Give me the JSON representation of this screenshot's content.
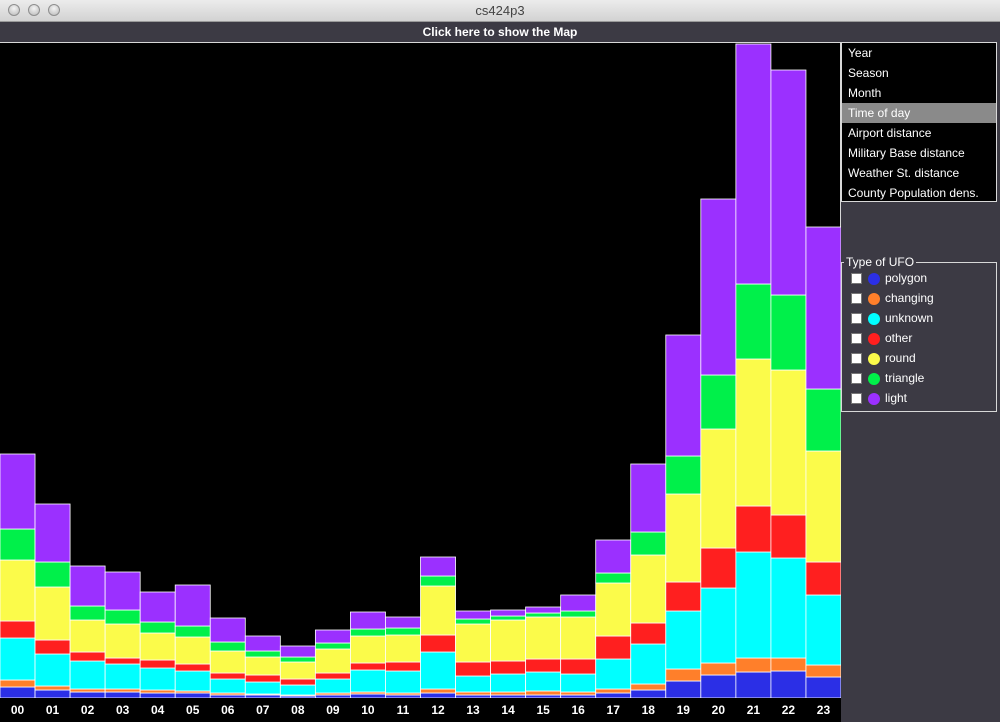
{
  "window": {
    "title": "cs424p3"
  },
  "map_button": "Click here to show the Map",
  "menu": {
    "items": [
      "Year",
      "Season",
      "Month",
      "Time of day",
      "Airport distance",
      "Military Base distance",
      "Weather St. distance",
      "County Population dens."
    ],
    "selected": "Time of day"
  },
  "legend": {
    "title": "Type of UFO",
    "items": [
      {
        "name": "polygon",
        "color": "#2b2fe6"
      },
      {
        "name": "changing",
        "color": "#ff7f2a"
      },
      {
        "name": "unknown",
        "color": "#00ffff"
      },
      {
        "name": "other",
        "color": "#ff1f1f"
      },
      {
        "name": "round",
        "color": "#fbfb4a"
      },
      {
        "name": "triangle",
        "color": "#00f04a"
      },
      {
        "name": "light",
        "color": "#9b30ff"
      }
    ]
  },
  "chart_data": {
    "type": "bar",
    "stacked": true,
    "categories": [
      "00",
      "01",
      "02",
      "03",
      "04",
      "05",
      "06",
      "07",
      "08",
      "09",
      "10",
      "11",
      "12",
      "13",
      "14",
      "15",
      "16",
      "17",
      "18",
      "19",
      "20",
      "21",
      "22",
      "23"
    ],
    "ylim": [
      0,
      655
    ],
    "series": [
      {
        "name": "polygon",
        "color": "#2b2fe6",
        "values": [
          11,
          8,
          6,
          6,
          5,
          5,
          3,
          3,
          2,
          3,
          4,
          3,
          5,
          3,
          3,
          3,
          3,
          5,
          8,
          17,
          23,
          26,
          27,
          21
        ]
      },
      {
        "name": "changing",
        "color": "#ff7f2a",
        "values": [
          7,
          4,
          3,
          3,
          3,
          2,
          2,
          1,
          1,
          2,
          2,
          2,
          4,
          3,
          3,
          4,
          3,
          4,
          6,
          12,
          12,
          14,
          13,
          12
        ]
      },
      {
        "name": "unknown",
        "color": "#00ffff",
        "values": [
          42,
          32,
          28,
          25,
          22,
          20,
          14,
          12,
          10,
          14,
          22,
          22,
          37,
          16,
          18,
          19,
          18,
          30,
          40,
          58,
          75,
          106,
          100,
          70
        ]
      },
      {
        "name": "other",
        "color": "#ff1f1f",
        "values": [
          17,
          14,
          9,
          6,
          8,
          7,
          6,
          7,
          6,
          6,
          7,
          9,
          17,
          14,
          13,
          13,
          15,
          23,
          21,
          29,
          40,
          46,
          43,
          33
        ]
      },
      {
        "name": "round",
        "color": "#fbfb4a",
        "values": [
          61,
          53,
          32,
          34,
          27,
          27,
          22,
          18,
          17,
          24,
          27,
          27,
          49,
          38,
          41,
          42,
          42,
          53,
          68,
          88,
          119,
          147,
          145,
          111
        ]
      },
      {
        "name": "triangle",
        "color": "#00f04a",
        "values": [
          31,
          25,
          14,
          14,
          11,
          11,
          9,
          6,
          5,
          6,
          7,
          7,
          10,
          5,
          4,
          4,
          6,
          10,
          23,
          38,
          54,
          75,
          75,
          62
        ]
      },
      {
        "name": "light",
        "color": "#9b30ff",
        "values": [
          75,
          58,
          40,
          38,
          30,
          41,
          24,
          15,
          11,
          13,
          17,
          11,
          19,
          8,
          6,
          6,
          16,
          33,
          68,
          121,
          176,
          240,
          225,
          162
        ]
      }
    ]
  }
}
